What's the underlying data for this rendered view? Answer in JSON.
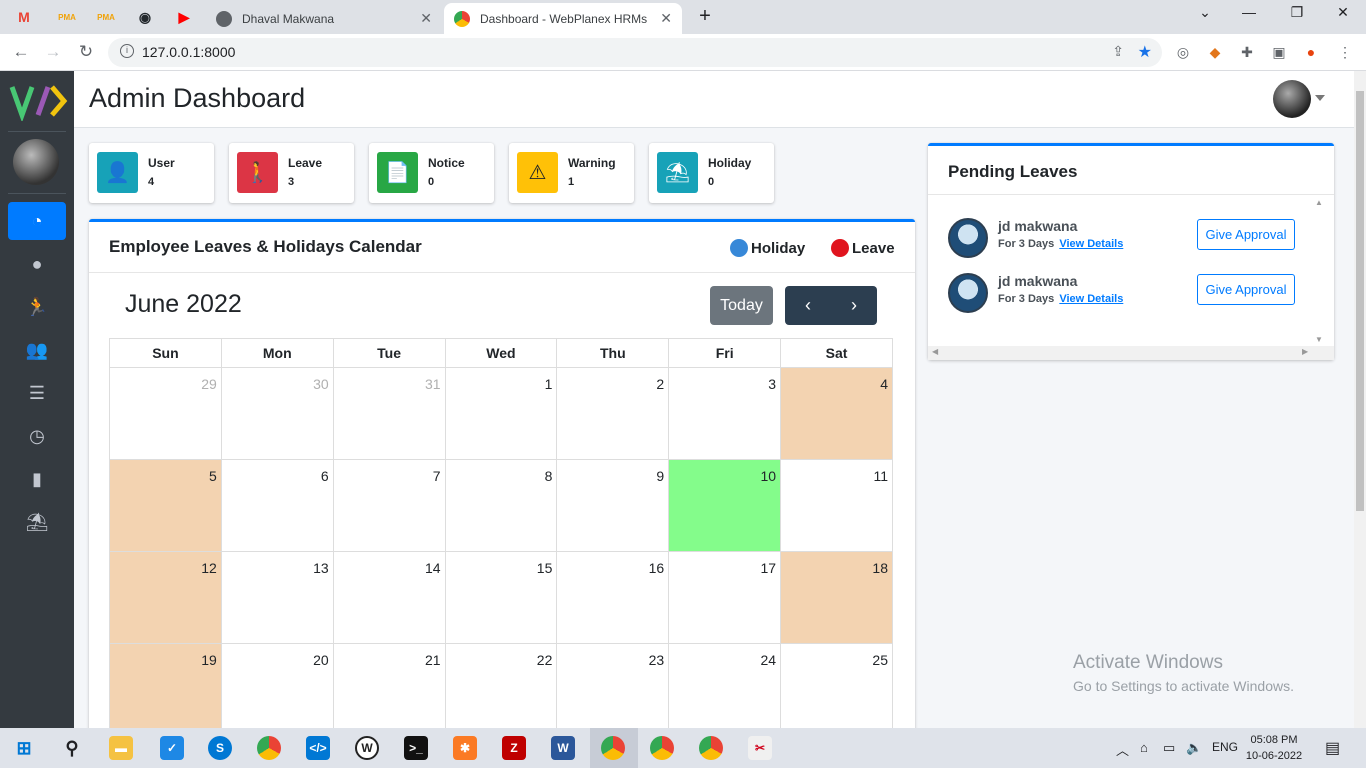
{
  "browser": {
    "pinned_tabs": [
      {
        "icon": "gmail-icon",
        "glyph": "M",
        "color": "#ea4335"
      },
      {
        "icon": "pma-icon",
        "glyph": "PMA",
        "color": "#f0a30a"
      },
      {
        "icon": "pma-icon",
        "glyph": "PMA",
        "color": "#f0a30a"
      },
      {
        "icon": "github-icon",
        "glyph": "◉",
        "color": "#24292e"
      },
      {
        "icon": "youtube-icon",
        "glyph": "▶",
        "color": "#ff0000"
      }
    ],
    "tabs": [
      {
        "title": "Dhaval Makwana",
        "active": false
      },
      {
        "title": "Dashboard - WebPlanex HRMs",
        "active": true
      }
    ],
    "new_tab": "+",
    "url": "127.0.0.1:8000"
  },
  "app": {
    "page_title": "Admin Dashboard",
    "sidebar_items": [
      "dashboard",
      "users",
      "leaves",
      "employees",
      "tasks",
      "attendance",
      "notices",
      "holidays"
    ]
  },
  "stats": [
    {
      "label": "User",
      "value": "4",
      "color": "#17a2b8",
      "icon": "user-icon",
      "glyph": "👤"
    },
    {
      "label": "Leave",
      "value": "3",
      "color": "#dc3545",
      "icon": "walking-icon",
      "glyph": "🚶"
    },
    {
      "label": "Notice",
      "value": "0",
      "color": "#28a745",
      "icon": "file-icon",
      "glyph": "📄"
    },
    {
      "label": "Warning",
      "value": "1",
      "color": "#ffc107",
      "icon": "warning-icon",
      "glyph": "⚠"
    },
    {
      "label": "Holiday",
      "value": "0",
      "color": "#17a2b8",
      "icon": "holiday-icon",
      "glyph": "⛱"
    }
  ],
  "calendar": {
    "card_title": "Employee Leaves & Holidays Calendar",
    "legend": [
      {
        "label": "Holiday",
        "color": "#3788d8"
      },
      {
        "label": "Leave",
        "color": "#e0141e"
      }
    ],
    "month_title": "June 2022",
    "today_label": "Today",
    "prev_glyph": "‹",
    "next_glyph": "›",
    "weekdays": [
      "Sun",
      "Mon",
      "Tue",
      "Wed",
      "Thu",
      "Fri",
      "Sat"
    ],
    "weeks": [
      [
        "29",
        "30",
        "31",
        "1",
        "2",
        "3",
        "4"
      ],
      [
        "5",
        "6",
        "7",
        "8",
        "9",
        "10",
        "11"
      ],
      [
        "12",
        "13",
        "14",
        "15",
        "16",
        "17",
        "18"
      ],
      [
        "19",
        "20",
        "21",
        "22",
        "23",
        "24",
        "25"
      ]
    ],
    "other_month": [
      [
        0,
        0
      ],
      [
        0,
        1
      ],
      [
        0,
        2
      ]
    ],
    "weekend_cells": [
      [
        0,
        6
      ],
      [
        1,
        0
      ],
      [
        2,
        0
      ],
      [
        2,
        6
      ],
      [
        3,
        0
      ]
    ],
    "today_cell": [
      1,
      5
    ]
  },
  "pending": {
    "title": "Pending Leaves",
    "items": [
      {
        "name": "jd makwana",
        "days": "For 3 Days",
        "link": "View Details",
        "button": "Give Approval"
      },
      {
        "name": "jd makwana",
        "days": "For 3 Days",
        "link": "View Details",
        "button": "Give Approval"
      }
    ]
  },
  "watermark": {
    "line1": "Activate Windows",
    "line2": "Go to Settings to activate Windows."
  },
  "taskbar": {
    "lang": "ENG",
    "time": "05:08 PM",
    "date": "10-06-2022"
  }
}
